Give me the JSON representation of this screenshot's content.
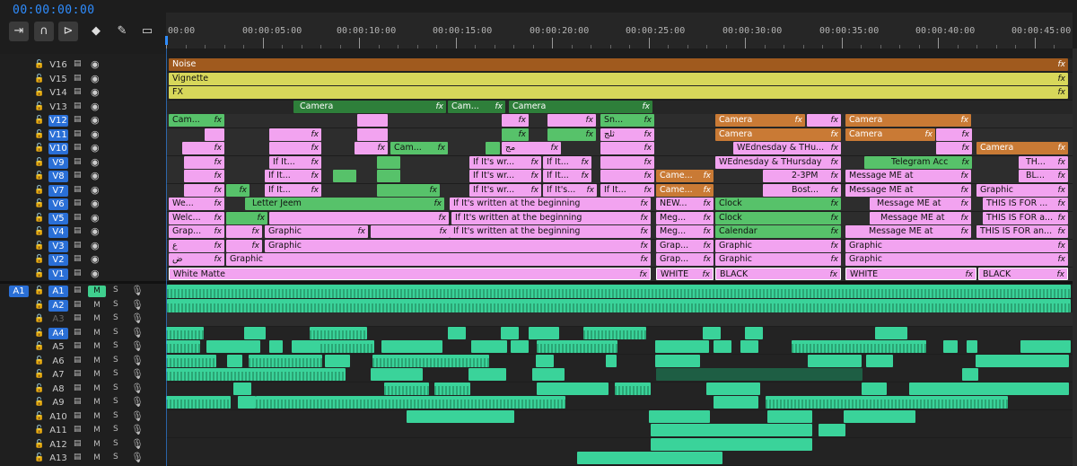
{
  "timecode": "00:00:00:00",
  "ruler": [
    "00:00",
    "00:00:05:00",
    "00:00:10:00",
    "00:00:15:00",
    "00:00:20:00",
    "00:00:25:00",
    "00:00:30:00",
    "00:00:35:00",
    "00:00:40:00",
    "00:00:45:00"
  ],
  "video_tracks": [
    "V16",
    "V15",
    "V14",
    "V13",
    "V12",
    "V11",
    "V10",
    "V9",
    "V8",
    "V7",
    "V6",
    "V5",
    "V4",
    "V3",
    "V2",
    "V1"
  ],
  "audio_tracks": [
    "A1",
    "A2",
    "A3",
    "A4",
    "A5",
    "A6",
    "A7",
    "A8",
    "A9",
    "A10",
    "A11",
    "A12",
    "A13"
  ],
  "source_label": "A1",
  "mute_label": "M",
  "solo_label": "S",
  "fx_label": "fx",
  "clips": {
    "noise": "Noise",
    "vignette": "Vignette",
    "fx_layer": "FX",
    "camera": "Camera",
    "cam_short": "Cam...",
    "came_short": "Came...",
    "sn_short": "Sn...",
    "graphic": "Graphic",
    "grap_short": "Grap...",
    "meg_short": "Meg...",
    "welc_short": "Welc...",
    "we_short": "We...",
    "new_short": "NEW...",
    "if_it": "If It...",
    "if_its_short": "If It's...",
    "if_its_wr": "If It's wr...",
    "if_its_written": "If It's written at the beginning",
    "letter_jeem": "Letter Jeem",
    "white_matte": "White Matte",
    "white": "WHITE",
    "black": "BLACK",
    "clock": "Clock",
    "calendar": "Calendar",
    "wed_thu_short": "WEdnesday & THu...",
    "wed_thu": "WEdnesday & THursday",
    "two_three_pm": "2-3PM",
    "bost_short": "Bost...",
    "message_me": "Message ME at",
    "telegram": "Telegram Acc",
    "this_is_for": "THIS IS FOR ...",
    "this_is_for_a": "THIS IS FOR a...",
    "this_is_for_an": "THIS IS FOR an...",
    "th_short": "TH...",
    "bl_short": "BL...",
    "arabic_ain": "ع",
    "arabic_dad": "ض",
    "arabic_haj": "ثلج",
    "arabic_maj": "مج"
  }
}
